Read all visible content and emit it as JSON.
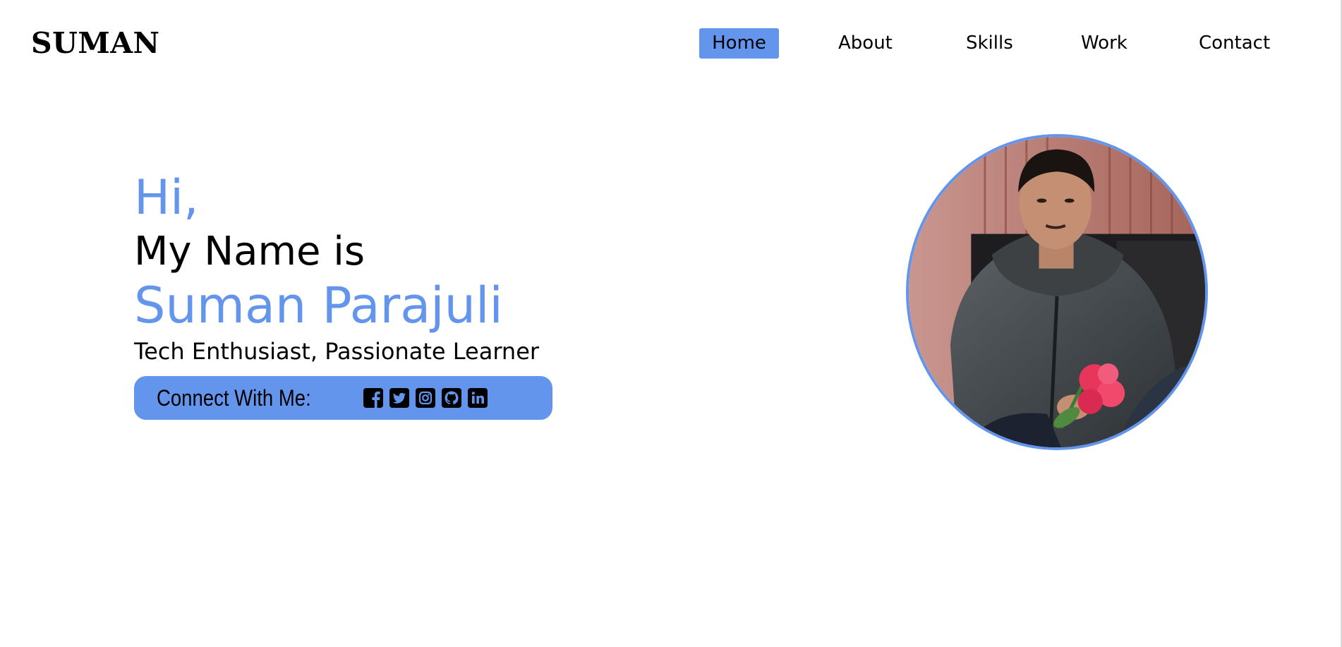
{
  "header": {
    "logo": "SUMAN",
    "nav": [
      {
        "label": "Home",
        "active": true
      },
      {
        "label": "About",
        "active": false
      },
      {
        "label": "Skills",
        "active": false
      },
      {
        "label": "Work",
        "active": false
      },
      {
        "label": "Contact",
        "active": false
      }
    ]
  },
  "hero": {
    "greeting": "Hi,",
    "intro": "My Name is",
    "name": "Suman Parajuli",
    "tagline": "Tech Enthusiast, Passionate Learner",
    "connect_label": "Connect With Me:",
    "social_icons": [
      "facebook-icon",
      "twitter-icon",
      "instagram-icon",
      "github-icon",
      "linkedin-icon"
    ]
  },
  "colors": {
    "accent": "#6495ED",
    "text": "#000000",
    "background": "#FFFFFF"
  }
}
